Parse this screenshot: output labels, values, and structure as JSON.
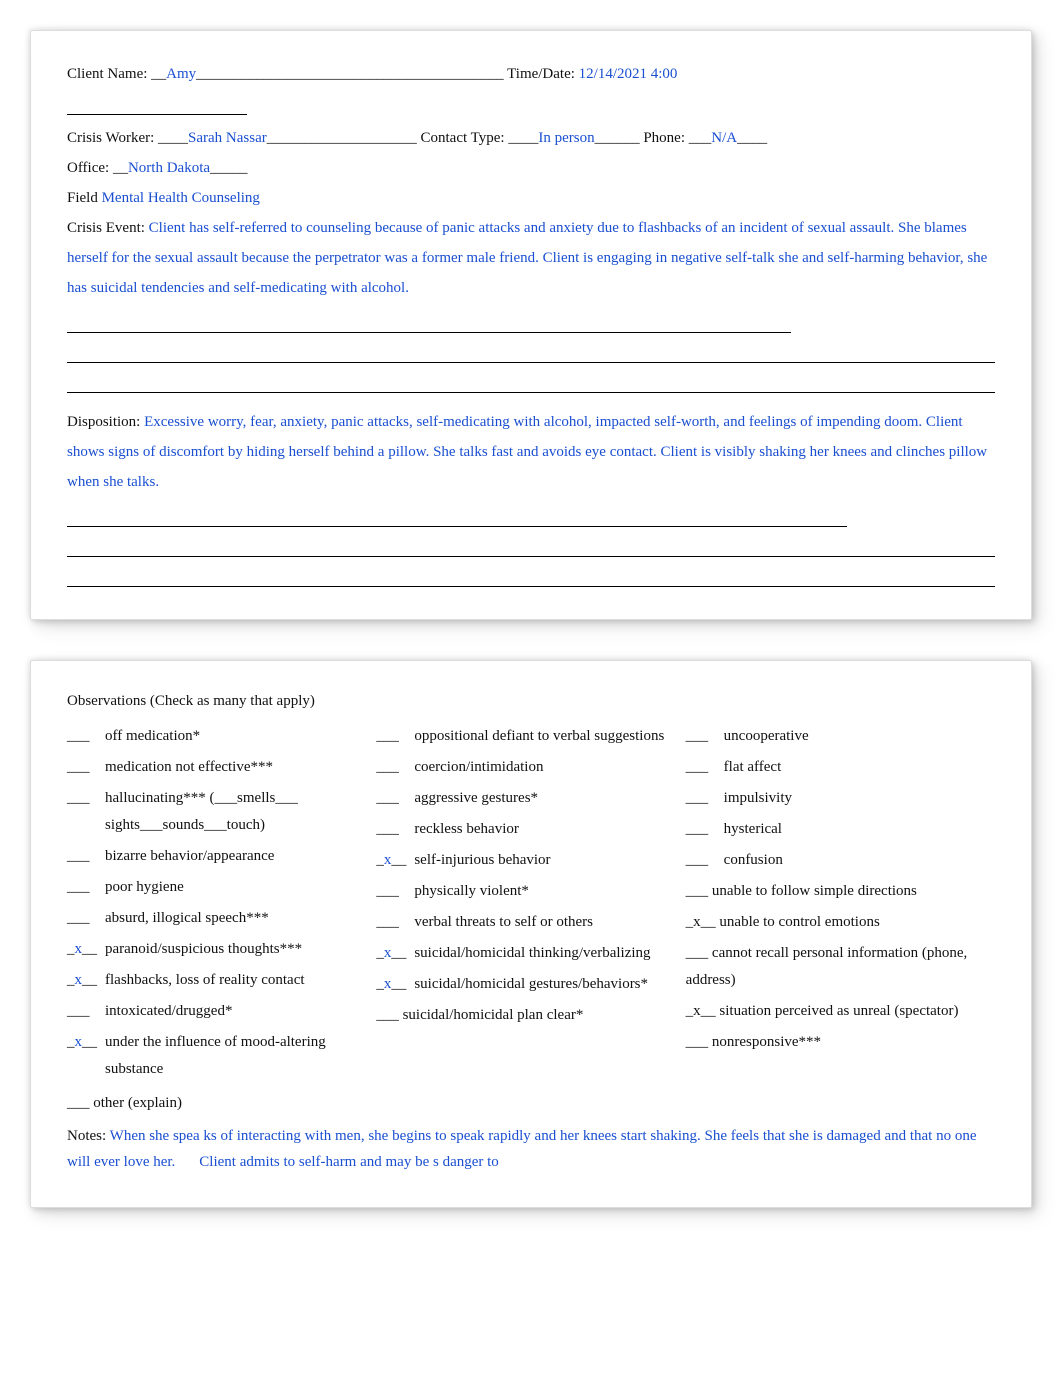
{
  "header": {
    "client_name_label": "Client Name: __",
    "client_name_value": "Amy",
    "client_name_trail": "_________________________________________",
    "time_label": " Time/Date: ",
    "time_value": "12/14/2021 4:00",
    "crisis_worker_label": "Crisis Worker: ____",
    "crisis_worker_value": "Sarah Nassar",
    "crisis_worker_trail": "____________________",
    "contact_type_label": " Contact Type: ____",
    "contact_type_value": "In person",
    "contact_type_trail": "______",
    "phone_label": " Phone: ___",
    "phone_value": "N/A",
    "phone_trail": "____",
    "office_label": "Office: __",
    "office_value": "North Dakota",
    "office_trail": "_____",
    "field_label": "Field ",
    "field_value": "Mental Health Counseling",
    "crisis_event_label": "Crisis Event: ",
    "crisis_event_value": "Client has self-referred to counseling because of panic attacks and anxiety due to flashbacks of an incident of sexual assault. She blames herself for the sexual assault because the perpetrator was a former male friend. Client is engaging in negative self-talk she and self-harming behavior, she has suicidal tendencies and self-medicating with alcohol.",
    "disposition_label": "Disposition: ",
    "disposition_value": "Excessive worry, fear, anxiety, panic attacks, self-medicating with alcohol, impacted self-worth, and feelings of impending doom. Client shows signs of discomfort by hiding herself behind a pillow. She talks fast and avoids eye contact. Client is visibly shaking her knees and clinches pillow when she talks."
  },
  "observations": {
    "title": "Observations   (Check as many that apply)",
    "col1": [
      {
        "checked": false,
        "label": "off medication*"
      },
      {
        "checked": false,
        "label": "medication not effective***"
      },
      {
        "checked": false,
        "label": "hallucinating*** (___smells___ sights___sounds___touch)"
      },
      {
        "checked": false,
        "label": "bizarre behavior/appearance"
      },
      {
        "checked": false,
        "label": "poor hygiene"
      },
      {
        "checked": false,
        "label": "absurd, illogical speech***"
      },
      {
        "checked": true,
        "label": "paranoid/suspicious thoughts***"
      },
      {
        "checked": true,
        "label": "flashbacks, loss of reality contact"
      },
      {
        "checked": false,
        "label": "intoxicated/drugged*"
      },
      {
        "checked": true,
        "label": "under the influence of mood-altering\nsubstance"
      }
    ],
    "other_label": "___ other (explain)",
    "col2": [
      {
        "checked": false,
        "label": "oppositional defiant to verbal suggestions"
      },
      {
        "checked": false,
        "label": "coercion/intimidation"
      },
      {
        "checked": false,
        "label": "aggressive gestures*"
      },
      {
        "checked": false,
        "label": "reckless behavior"
      },
      {
        "checked": true,
        "label": "self-injurious behavior"
      },
      {
        "checked": false,
        "label": "physically violent*"
      },
      {
        "checked": false,
        "label": "verbal threats to self or others"
      },
      {
        "checked": true,
        "label": "suicidal/homicidal thinking/verbalizing"
      },
      {
        "checked": true,
        "label": "suicidal/homicidal gestures/behaviors*"
      },
      {
        "checked": false,
        "label": "suicidal/homicidal plan clear*",
        "inline_blank": true
      }
    ],
    "col3": [
      {
        "checked": false,
        "label": "uncooperative"
      },
      {
        "checked": false,
        "label": "flat affect"
      },
      {
        "checked": false,
        "label": "impulsivity"
      },
      {
        "checked": false,
        "label": "hysterical"
      },
      {
        "checked": false,
        "label": "confusion"
      },
      {
        "checked": false,
        "label": "unable to follow simple directions",
        "tight": true
      },
      {
        "checked": true,
        "label": "unable to control emotions",
        "tight": true
      },
      {
        "checked": false,
        "label": "cannot recall personal information (phone, address)",
        "tight": true
      },
      {
        "checked": true,
        "label": "situation perceived as unreal (spectator)",
        "tight": true
      },
      {
        "checked": false,
        "label": "nonresponsive***",
        "tight": true
      }
    ],
    "notes_label": "Notes: ",
    "notes_value_a": "When she spea ks of interacting with men, she begins to speak rapidly and her knees start shaking. She feels that she is damaged and that no one will ever love her.",
    "notes_value_b": "Client admits to self-harm and may be s danger to"
  }
}
